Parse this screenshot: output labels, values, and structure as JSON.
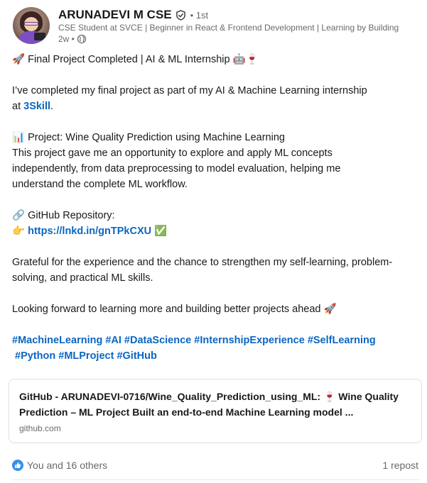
{
  "author": {
    "name": "ARUNADEVI M CSE",
    "degree": "• 1st",
    "headline": "CSE Student at SVCE | Beginner in React & Frontend Development | Learning by Building",
    "time": "2w •"
  },
  "post": {
    "line1": "🚀 Final Project Completed | AI & ML Internship 🤖🍷",
    "line3": "I’ve completed my final project as part of my AI & Machine Learning internship",
    "line4_prefix": "at ",
    "line4_link": "3Skill",
    "line4_suffix": ".",
    "line6": "📊 Project: Wine Quality Prediction using Machine Learning",
    "line7": "This project gave me an opportunity to explore and apply ML concepts",
    "line8": "independently, from data preprocessing to model evaluation, helping me",
    "line9": "understand the complete ML workflow.",
    "line11": "🔗 GitHub Repository:",
    "line12_icon": "👉",
    "line12_link": "https://lnkd.in/gnTPkCXU",
    "line12_check": "✅",
    "line14": "Grateful for the experience and the chance to strengthen my self-learning, problem-",
    "line15": "solving, and practical ML skills.",
    "line17": "Looking forward to learning more and building better projects ahead 🚀",
    "hashtags1": "#MachineLearning #AI #DataScience #InternshipExperience #SelfLearning",
    "hashtags2": " #Python #MLProject #GitHub"
  },
  "card": {
    "title": "GitHub - ARUNADEVI-0716/Wine_Quality_Prediction_using_ML: 🍷 Wine Quality Prediction – ML Project Built an end-to-end Machine Learning model ...",
    "domain": "github.com"
  },
  "social": {
    "reactions": "You and 16 others",
    "reposts": "1 repost"
  },
  "colors": {
    "link": "#0a66c2",
    "verified": "#404040",
    "like": "#378fe9"
  },
  "icons": {
    "verified": "verified-shield-icon",
    "visibility": "globe-icon",
    "reaction": "like-icon"
  }
}
